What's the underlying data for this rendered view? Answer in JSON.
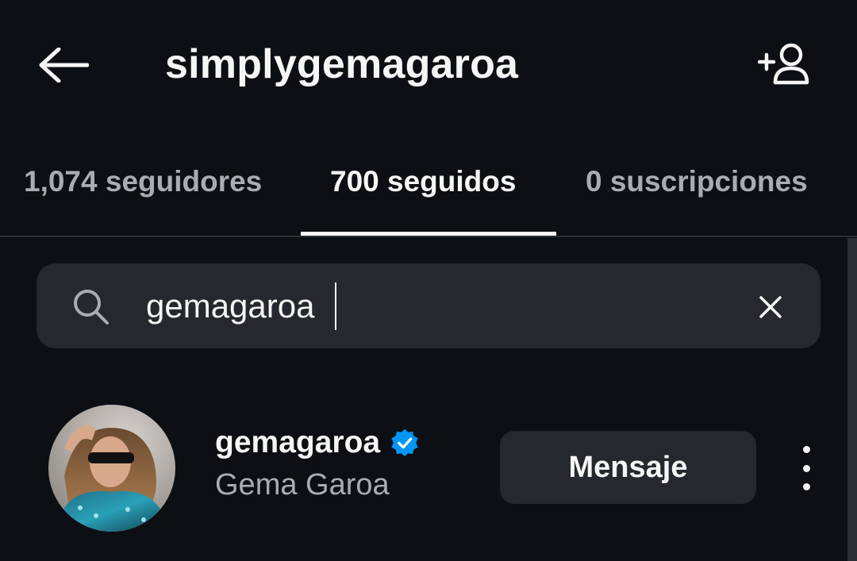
{
  "header": {
    "title": "simplygemagaroa",
    "back_icon": "arrow-left-icon",
    "add_user_icon": "add-user-icon"
  },
  "tabs": [
    {
      "label": "1,074 seguidores",
      "active": false
    },
    {
      "label": "700 seguidos",
      "active": true
    },
    {
      "label": "0 suscripciones",
      "active": false
    }
  ],
  "search": {
    "value": "gemagaroa",
    "placeholder": "",
    "icon": "search-icon",
    "clear_icon": "close-icon"
  },
  "results": [
    {
      "username": "gemagaroa",
      "full_name": "Gema Garoa",
      "verified": true,
      "action_label": "Mensaje",
      "more_icon": "more-vertical-icon"
    }
  ],
  "colors": {
    "background": "#0c0f14",
    "surface": "#25282e",
    "text_primary": "#f5f5f5",
    "text_secondary": "#a8acb3",
    "verified_blue": "#0095f6"
  }
}
